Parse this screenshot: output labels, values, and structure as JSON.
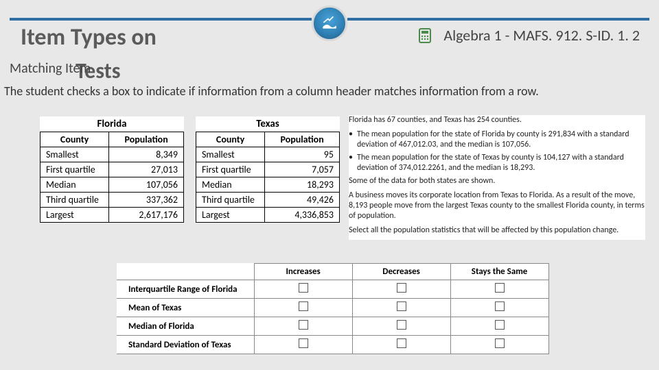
{
  "header": {
    "title_main": "Item Types on",
    "title_sub": "Tests",
    "subtitle": "Matching Item",
    "standard": "Algebra 1 - MAFS. 912. S-ID. 1. 2"
  },
  "body": {
    "instruction": "The student checks a box to indicate if information from a column header matches information from a row."
  },
  "tables": {
    "florida": {
      "title": "Florida",
      "col1": "County",
      "col2": "Population",
      "rows": [
        {
          "label": "Smallest",
          "value": "8,349"
        },
        {
          "label": "First quartile",
          "value": "27,013"
        },
        {
          "label": "Median",
          "value": "107,056"
        },
        {
          "label": "Third quartile",
          "value": "337,362"
        },
        {
          "label": "Largest",
          "value": "2,617,176"
        }
      ]
    },
    "texas": {
      "title": "Texas",
      "col1": "County",
      "col2": "Population",
      "rows": [
        {
          "label": "Smallest",
          "value": "95"
        },
        {
          "label": "First quartile",
          "value": "7,057"
        },
        {
          "label": "Median",
          "value": "18,293"
        },
        {
          "label": "Third quartile",
          "value": "49,426"
        },
        {
          "label": "Largest",
          "value": "4,336,853"
        }
      ]
    }
  },
  "explain": {
    "intro": "Florida has 67 counties, and Texas has 254 counties.",
    "bullet1": "The mean population for the state of Florida by county is 291,834 with a standard deviation of 467,012.03, and the median is 107,056.",
    "bullet2": "The mean population for the state of Texas by county is 104,127 with a standard deviation of 374,012.2261, and the median is 18,293.",
    "shown": "Some of the data for both states are shown.",
    "move": "A business moves its corporate location from Texas to Florida. As a result of the move, 8,193 people move from the largest Texas county to the smallest Florida county, in terms of population.",
    "select": "Select all the population statistics that will be affected by this population change."
  },
  "match": {
    "columns": [
      "Increases",
      "Decreases",
      "Stays the Same"
    ],
    "rows": [
      "Interquartile Range of Florida",
      "Mean of Texas",
      "Median of Florida",
      "Standard Deviation of Texas"
    ]
  }
}
